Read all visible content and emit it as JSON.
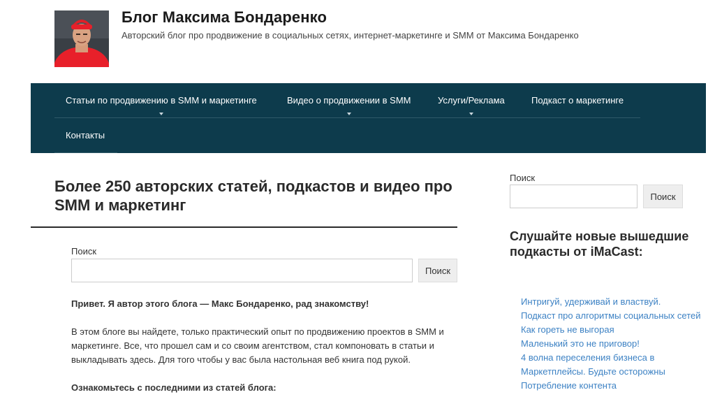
{
  "header": {
    "site_title": "Блог Максима Бондаренко",
    "site_description": "Авторский блог про продвижение в социальных сетях, интернет-маркетинге и SMM от Максима Бондаренко"
  },
  "nav": {
    "items": [
      {
        "label": "Статьи по продвижению в SMM и маркетинге",
        "has_submenu": true
      },
      {
        "label": "Видео о продвижении в SMM",
        "has_submenu": true
      },
      {
        "label": "Услуги/Реклама",
        "has_submenu": true
      },
      {
        "label": "Подкаст о маркетинге",
        "has_submenu": false
      },
      {
        "label": "Контакты",
        "has_submenu": false
      }
    ]
  },
  "main": {
    "title": "Более 250 авторских статей, подкастов и видео про SMM и маркетинг",
    "search": {
      "label": "Поиск",
      "value": "",
      "button": "Поиск"
    },
    "greeting": "Привет. Я автор этого блога — Макс Бондаренко, рад знакомству!",
    "intro": "В этом блоге вы найдете, только практический опыт по продвижению проектов в SMM и маркетинге. Все, что прошел сам и со своим агентством, стал компоновать в статьи и выкладывать здесь. Для того чтобы у вас была настольная веб книга под рукой.",
    "latest_heading": "Ознакомьтесь с последними из статей блога:"
  },
  "sidebar": {
    "search": {
      "label": "Поиск",
      "value": "",
      "button": "Поиск"
    },
    "podcast_widget_title": "Слушайте новые вышедшие подкасты от iMaCast:",
    "podcasts": [
      "Интригуй, удерживай и властвуй.",
      "Подкаст про алгоритмы социальных сетей",
      "Как гореть не выгорая",
      "Маленький это не приговор!",
      "4 волна переселения бизнеса в Маркетплейсы. Будьте осторожны",
      "Потребление контента"
    ]
  },
  "colors": {
    "nav_background": "#0d3b4c",
    "link": "#3d82c4",
    "text": "#333333"
  }
}
